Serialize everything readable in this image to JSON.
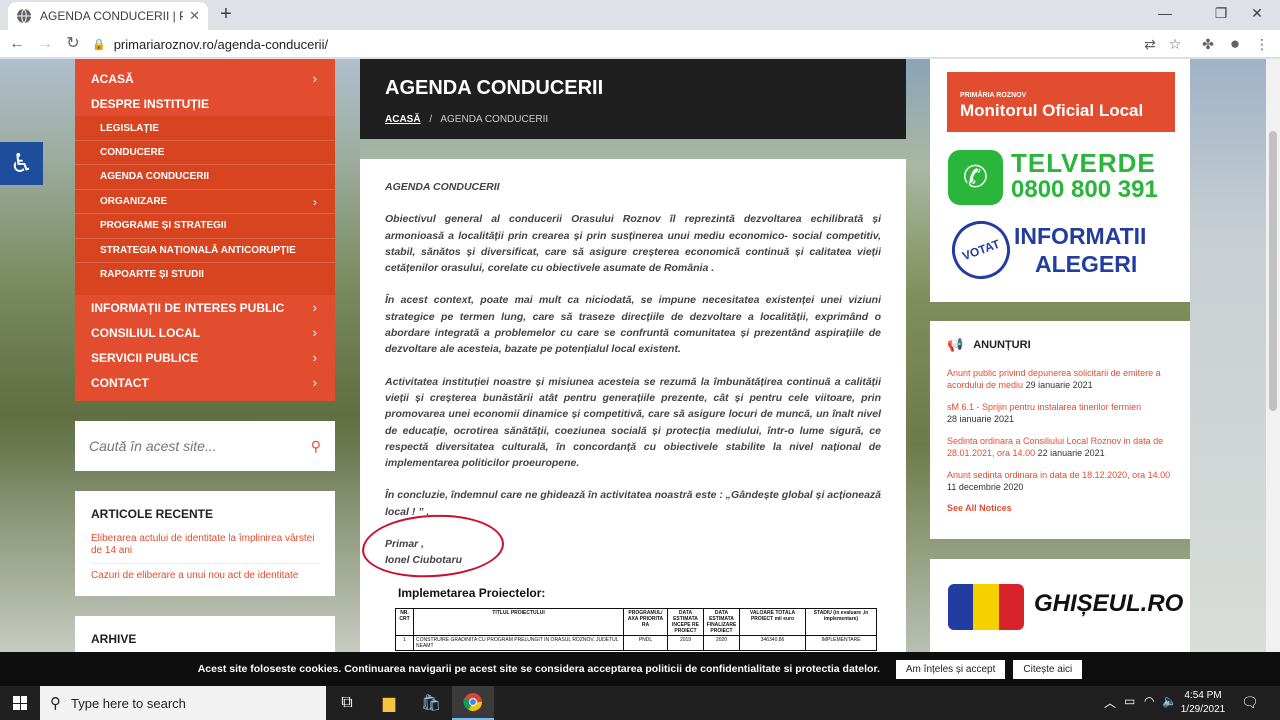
{
  "browser": {
    "tab_title": "AGENDA CONDUCERII | Pagina o",
    "url": "primariaroznov.ro/agenda-conducerii/"
  },
  "menu": {
    "items": [
      {
        "label": "ACASĂ",
        "chevron": true
      },
      {
        "label": "DESPRE INSTITUȚIE",
        "chevron": false
      }
    ],
    "submenu": [
      {
        "label": "LEGISLAȚIE",
        "chevron": false
      },
      {
        "label": "CONDUCERE",
        "chevron": false
      },
      {
        "label": "AGENDA CONDUCERII",
        "chevron": false
      },
      {
        "label": "ORGANIZARE",
        "chevron": true
      },
      {
        "label": "PROGRAME ȘI STRATEGII",
        "chevron": false
      },
      {
        "label": "STRATEGIA NAȚIONALĂ ANTICORUPȚIE",
        "chevron": false
      },
      {
        "label": "RAPOARTE ȘI STUDII",
        "chevron": false
      }
    ],
    "bottom_items": [
      {
        "label": "INFORMAȚII DE INTERES PUBLIC"
      },
      {
        "label": "CONSILIUL LOCAL"
      },
      {
        "label": "SERVICII PUBLICE"
      },
      {
        "label": "CONTACT"
      }
    ]
  },
  "search": {
    "placeholder": "Caută în acest site..."
  },
  "recent": {
    "title": "ARTICOLE RECENTE",
    "items": [
      "Eliberarea actului de identitate la împlinirea vârstei de 14 ani",
      "Cazuri de eliberare a unui nou act de identitate"
    ]
  },
  "archive": {
    "title": "ARHIVE"
  },
  "hero": {
    "title": "AGENDA CONDUCERII",
    "crumb_home": "ACASĂ",
    "crumb_sep": "/",
    "crumb_current": "AGENDA CONDUCERII"
  },
  "article": {
    "heading": "AGENDA CONDUCERII",
    "p1": "Obiectivul general al conducerii Orasului Roznov îl reprezintă dezvoltarea echilibrată și armonioasă a localității prin crearea și prin susținerea unui mediu economico- social competitiv, stabil, sănătos și diversificat, care să asigure creșterea economică continuă și calitatea vieții cetățenilor orasului, corelate cu obiectivele asumate de România .",
    "p2": "În acest context, poate mai mult ca niciodată, se impune necesitatea existenței unei viziuni strategice pe termen lung, care să traseze direcțiile de dezvoltare a localității, exprimând o abordare integrată a problemelor cu care se confruntă comunitatea și prezentând aspirațiile de dezvoltare ale acesteia, bazate pe potențialul local existent.",
    "p3": "Activitatea instituției noastre și misiunea acesteia se rezumă la îmbunătățirea continuă a calității vieții și creșterea bunăstării atât pentru generațiile prezente, cât și pentru cele viitoare, prin promovarea unei economii dinamice și competitivă, care să asigure locuri de muncă, un înalt nivel de educație, ocrotirea sănătății, coeziunea socială și protecția mediului, într-o lume sigură, ce respectă diversitatea culturală, în concordanță cu obiectivele stabilite la nivel național de implementarea politicilor proeuropene.",
    "p4": "În concluzie, îndemnul care ne ghidează în activitatea noastră este : „Gândește global și acționează local ! ” .",
    "sig1": "Primar ,",
    "sig2": "Ionel Ciubotaru",
    "projects_title": "Implemetarea Proiectelor:",
    "table": {
      "headers": [
        "NR. CRT",
        "TITLUL PROIECTULUI",
        "PROGRAMUL/ AXA PRIORITA RA",
        "DATA ESTIMATA INCEPE RE PROIECT",
        "DATA ESTIMATA FINALIZARE PROIECT",
        "VALOARE TOTALA PROIECT mii euro",
        "STADIU (in evaluare ,in implementare)"
      ],
      "rows": [
        [
          "1",
          "CONSTRUIRE GRADINITA CU PROGRAM PRELUNGIT IN ORASUL ROZNOV, JUDETUL NEAMT",
          "PNDL",
          "2019",
          "2020",
          "346340,86",
          "IMPLEMENTARE"
        ]
      ]
    }
  },
  "right": {
    "monitor_small": "PRIMĂRIA ROZNOV",
    "monitor_big": "Monitorul Oficial Local",
    "telverde_1": "TELVERDE",
    "telverde_2": "0800 800 391",
    "votat": "VOTAT",
    "informatii": "INFORMATII",
    "alegeri": "ALEGERI"
  },
  "notices": {
    "title": "ANUNȚURI",
    "items": [
      {
        "title": "Anunt public privind depunerea solicitarii de emitere a acordului de mediu",
        "date": "29 ianuarie 2021"
      },
      {
        "title": "sM 6.1 - Sprijin pentru instalarea tinerilor fermieri",
        "date": "28 ianuarie 2021"
      },
      {
        "title": "Sedinta ordinara a Consiliului Local Roznov in data de 28.01.2021, ora 14.00",
        "date": "22 ianuarie 2021"
      },
      {
        "title": "Anunt sedinta ordinara in data de 18.12.2020, ora 14.00",
        "date": "11 decembrie 2020"
      }
    ],
    "see_all": "See All Notices"
  },
  "ghiseul": {
    "text": "GHIȘEUL.RO"
  },
  "cookie": {
    "message": "Acest site foloseste cookies. Continuarea navigarii pe acest site se considera acceptarea politicii de confidentialitate si protectia datelor.",
    "accept": "Am înțeles și accept",
    "read": "Citește aici"
  },
  "taskbar": {
    "search_placeholder": "Type here to search",
    "time": "4:54 PM",
    "date": "1/29/2021"
  }
}
